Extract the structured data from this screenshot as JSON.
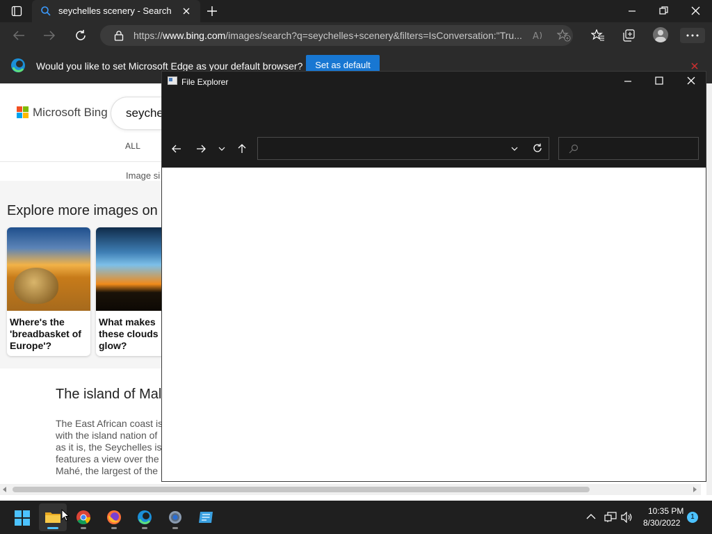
{
  "browser": {
    "tab_title": "seychelles scenery - Search",
    "url_prefix": "https://",
    "url_domain": "www.bing.com",
    "url_rest": "/images/search?q=seychelles+scenery&filters=IsConversation:\"Tru...",
    "infobar_message": "Would you like to set Microsoft Edge as your default browser?",
    "set_default_label": "Set as default"
  },
  "bing": {
    "logo_text": "Microsoft Bing",
    "search_text": "seyche",
    "tab_all": "ALL",
    "filter_label": "Image si",
    "explore_title": "Explore more images on",
    "cards": [
      {
        "caption": "Where's the 'breadbasket of Europe'?"
      },
      {
        "caption": "What makes these clouds glow?"
      }
    ],
    "article_title": "The island of Mal",
    "article_body": "The East African coast is\nwith the island nation of\nas it is, the Seychelles is\nfeatures a view over the\nMahé, the largest of the i"
  },
  "file_explorer": {
    "title": "File Explorer",
    "address_value": "",
    "search_value": ""
  },
  "taskbar": {
    "time": "10:35 PM",
    "date": "8/30/2022",
    "notification_count": "1"
  },
  "colors": {
    "accent": "#1877d2",
    "dark": "#202020",
    "explorer_dark": "#1c1c1c"
  }
}
